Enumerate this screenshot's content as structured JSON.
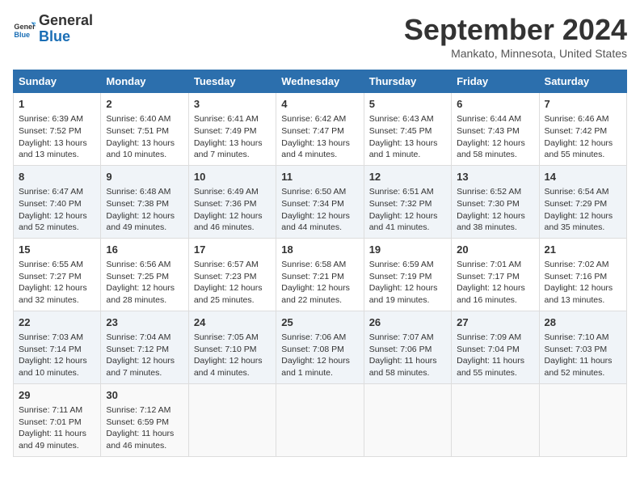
{
  "header": {
    "logo_general": "General",
    "logo_blue": "Blue",
    "title": "September 2024",
    "subtitle": "Mankato, Minnesota, United States"
  },
  "days_of_week": [
    "Sunday",
    "Monday",
    "Tuesday",
    "Wednesday",
    "Thursday",
    "Friday",
    "Saturday"
  ],
  "weeks": [
    [
      {
        "day": "1",
        "sunrise": "6:39 AM",
        "sunset": "7:52 PM",
        "daylight": "13 hours and 13 minutes."
      },
      {
        "day": "2",
        "sunrise": "6:40 AM",
        "sunset": "7:51 PM",
        "daylight": "13 hours and 10 minutes."
      },
      {
        "day": "3",
        "sunrise": "6:41 AM",
        "sunset": "7:49 PM",
        "daylight": "13 hours and 7 minutes."
      },
      {
        "day": "4",
        "sunrise": "6:42 AM",
        "sunset": "7:47 PM",
        "daylight": "13 hours and 4 minutes."
      },
      {
        "day": "5",
        "sunrise": "6:43 AM",
        "sunset": "7:45 PM",
        "daylight": "13 hours and 1 minute."
      },
      {
        "day": "6",
        "sunrise": "6:44 AM",
        "sunset": "7:43 PM",
        "daylight": "12 hours and 58 minutes."
      },
      {
        "day": "7",
        "sunrise": "6:46 AM",
        "sunset": "7:42 PM",
        "daylight": "12 hours and 55 minutes."
      }
    ],
    [
      {
        "day": "8",
        "sunrise": "6:47 AM",
        "sunset": "7:40 PM",
        "daylight": "12 hours and 52 minutes."
      },
      {
        "day": "9",
        "sunrise": "6:48 AM",
        "sunset": "7:38 PM",
        "daylight": "12 hours and 49 minutes."
      },
      {
        "day": "10",
        "sunrise": "6:49 AM",
        "sunset": "7:36 PM",
        "daylight": "12 hours and 46 minutes."
      },
      {
        "day": "11",
        "sunrise": "6:50 AM",
        "sunset": "7:34 PM",
        "daylight": "12 hours and 44 minutes."
      },
      {
        "day": "12",
        "sunrise": "6:51 AM",
        "sunset": "7:32 PM",
        "daylight": "12 hours and 41 minutes."
      },
      {
        "day": "13",
        "sunrise": "6:52 AM",
        "sunset": "7:30 PM",
        "daylight": "12 hours and 38 minutes."
      },
      {
        "day": "14",
        "sunrise": "6:54 AM",
        "sunset": "7:29 PM",
        "daylight": "12 hours and 35 minutes."
      }
    ],
    [
      {
        "day": "15",
        "sunrise": "6:55 AM",
        "sunset": "7:27 PM",
        "daylight": "12 hours and 32 minutes."
      },
      {
        "day": "16",
        "sunrise": "6:56 AM",
        "sunset": "7:25 PM",
        "daylight": "12 hours and 28 minutes."
      },
      {
        "day": "17",
        "sunrise": "6:57 AM",
        "sunset": "7:23 PM",
        "daylight": "12 hours and 25 minutes."
      },
      {
        "day": "18",
        "sunrise": "6:58 AM",
        "sunset": "7:21 PM",
        "daylight": "12 hours and 22 minutes."
      },
      {
        "day": "19",
        "sunrise": "6:59 AM",
        "sunset": "7:19 PM",
        "daylight": "12 hours and 19 minutes."
      },
      {
        "day": "20",
        "sunrise": "7:01 AM",
        "sunset": "7:17 PM",
        "daylight": "12 hours and 16 minutes."
      },
      {
        "day": "21",
        "sunrise": "7:02 AM",
        "sunset": "7:16 PM",
        "daylight": "12 hours and 13 minutes."
      }
    ],
    [
      {
        "day": "22",
        "sunrise": "7:03 AM",
        "sunset": "7:14 PM",
        "daylight": "12 hours and 10 minutes."
      },
      {
        "day": "23",
        "sunrise": "7:04 AM",
        "sunset": "7:12 PM",
        "daylight": "12 hours and 7 minutes."
      },
      {
        "day": "24",
        "sunrise": "7:05 AM",
        "sunset": "7:10 PM",
        "daylight": "12 hours and 4 minutes."
      },
      {
        "day": "25",
        "sunrise": "7:06 AM",
        "sunset": "7:08 PM",
        "daylight": "12 hours and 1 minute."
      },
      {
        "day": "26",
        "sunrise": "7:07 AM",
        "sunset": "7:06 PM",
        "daylight": "11 hours and 58 minutes."
      },
      {
        "day": "27",
        "sunrise": "7:09 AM",
        "sunset": "7:04 PM",
        "daylight": "11 hours and 55 minutes."
      },
      {
        "day": "28",
        "sunrise": "7:10 AM",
        "sunset": "7:03 PM",
        "daylight": "11 hours and 52 minutes."
      }
    ],
    [
      {
        "day": "29",
        "sunrise": "7:11 AM",
        "sunset": "7:01 PM",
        "daylight": "11 hours and 49 minutes."
      },
      {
        "day": "30",
        "sunrise": "7:12 AM",
        "sunset": "6:59 PM",
        "daylight": "11 hours and 46 minutes."
      },
      null,
      null,
      null,
      null,
      null
    ]
  ]
}
